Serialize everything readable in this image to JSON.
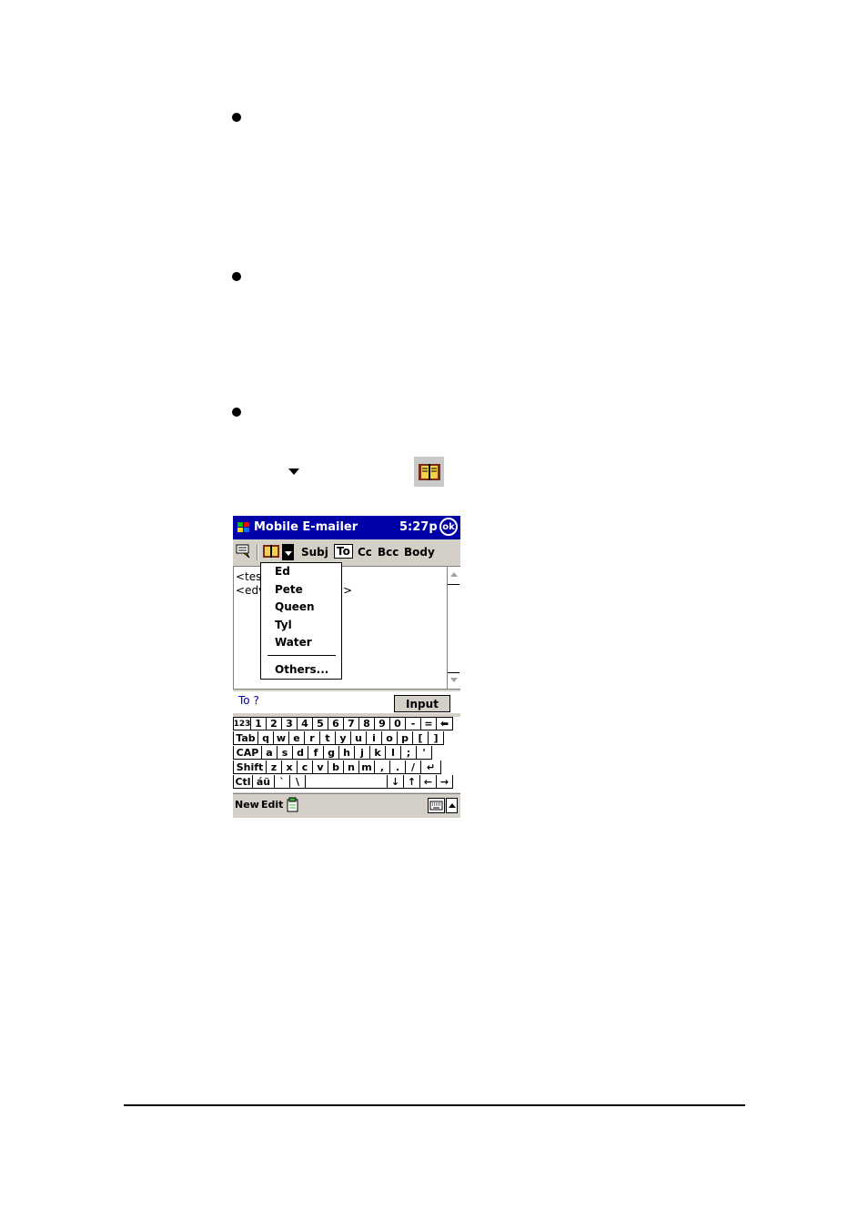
{
  "app": {
    "title": "Mobile E-mailer",
    "clock": "5:27p",
    "ok_label": "ok"
  },
  "toolbar": {
    "fields": [
      "Subj",
      "To",
      "Cc",
      "Bcc",
      "Body"
    ],
    "selected_field": "To"
  },
  "compose": {
    "line1": "<tes",
    "line2": "<edv",
    "line2_tail": ">"
  },
  "address_menu": {
    "items": [
      "Ed",
      "Pete",
      "Queen",
      "Tyl",
      "Water"
    ],
    "others_label": "Others..."
  },
  "input_row": {
    "prompt": "To ?",
    "button_label": "Input"
  },
  "keyboard": {
    "rows": [
      [
        "123",
        "1",
        "2",
        "3",
        "4",
        "5",
        "6",
        "7",
        "8",
        "9",
        "0",
        "-",
        "=",
        "⬅"
      ],
      [
        "Tab",
        "q",
        "w",
        "e",
        "r",
        "t",
        "y",
        "u",
        "i",
        "o",
        "p",
        "[",
        "]"
      ],
      [
        "CAP",
        "a",
        "s",
        "d",
        "f",
        "g",
        "h",
        "j",
        "k",
        "l",
        ";",
        "'"
      ],
      [
        "Shift",
        "z",
        "x",
        "c",
        "v",
        "b",
        "n",
        "m",
        ",",
        ".",
        "/",
        "↵"
      ],
      [
        "Ctl",
        "áü",
        "`",
        "\\",
        " ",
        "↓",
        "↑",
        "←",
        "→"
      ]
    ]
  },
  "menubar": {
    "new_label": "New",
    "edit_label": "Edit"
  }
}
